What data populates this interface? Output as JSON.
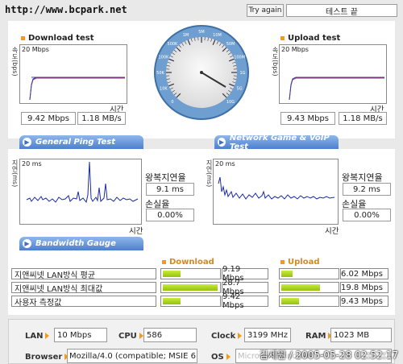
{
  "header": {
    "url": "http://www.bcpark.net",
    "try_again": "Try again",
    "status": "테스트 끝"
  },
  "download": {
    "title": "Download test",
    "axis_y": "속도(bps)",
    "scale": "20 Mbps",
    "axis_x": "시간",
    "mbps": "9.42 Mbps",
    "mbs": "1.18 MB/s"
  },
  "upload": {
    "title": "Upload test",
    "axis_y": "속도(bps)",
    "scale": "20 Mbps",
    "axis_x": "시간",
    "mbps": "9.43 Mbps",
    "mbs": "1.18 MB/s"
  },
  "gauge": {
    "ticks": [
      "0",
      "10K",
      "50K",
      "100K",
      "500K",
      "1M",
      "5M",
      "10M",
      "50M",
      "100M",
      "1G",
      "5G",
      "10G"
    ]
  },
  "tabs": {
    "ping": "General Ping Test",
    "game": "Network Game & VoIP Test",
    "bandwidth": "Bandwidth Gauge"
  },
  "ping": {
    "axis_y": "지연(ms)",
    "scale": "20 ms",
    "axis_x": "시간",
    "rtt_label": "왕복지연율",
    "rtt": "9.1 ms",
    "loss_label": "손실율",
    "loss": "0.00%"
  },
  "game": {
    "axis_y": "지연(ms)",
    "scale": "20 ms",
    "axis_x": "시간",
    "rtt_label": "왕복지연율",
    "rtt": "9.2 ms",
    "loss_label": "손실율",
    "loss": "0.00%"
  },
  "bandwidth": {
    "download_header": "Download",
    "upload_header": "Upload",
    "rows": [
      {
        "label": "지앤씨넷 LAN방식 평균",
        "download": "9.19 Mbps",
        "download_frac": 0.32,
        "upload": "6.02 Mbps",
        "upload_frac": 0.21
      },
      {
        "label": "지앤씨넷 LAN방식 최대값",
        "download": "28.7 Mbps",
        "download_frac": 0.98,
        "upload": "19.8 Mbps",
        "upload_frac": 0.7
      },
      {
        "label": "사용자 측정값",
        "download": "9.42 Mbps",
        "download_frac": 0.32,
        "upload": "9.43 Mbps",
        "upload_frac": 0.32
      }
    ]
  },
  "info": {
    "lan_label": "LAN",
    "lan": "10 Mbps",
    "cpu_label": "CPU",
    "cpu": "586",
    "clock_label": "Clock",
    "clock": "3199 MHz",
    "ram_label": "RAM",
    "ram": "1023 MB",
    "browser_label": "Browser",
    "browser": "Mozilla/4.0 (compatible; MSIE 6.0",
    "os_label": "OS",
    "os": "Microsoft Windows"
  },
  "watermark": "김세원 / 2005-05-28 02:52:17"
}
